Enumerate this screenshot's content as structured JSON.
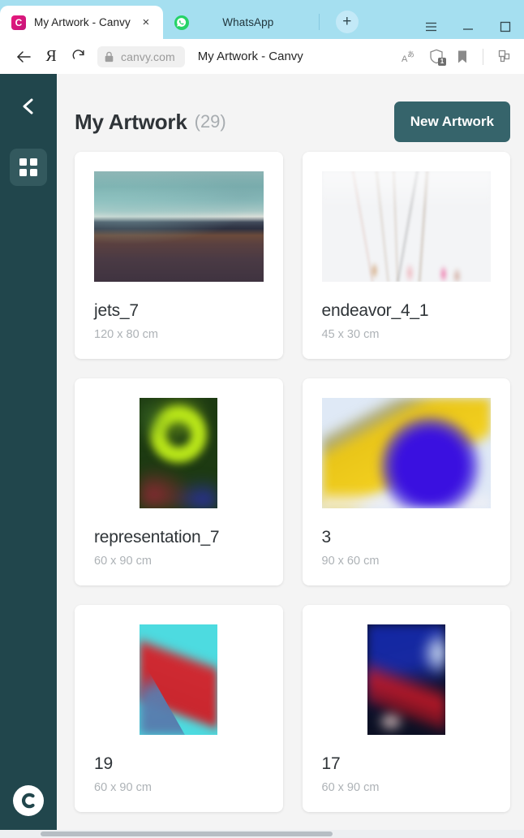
{
  "browser": {
    "tabs": [
      {
        "title": "My Artwork - Canvy",
        "favicon": "canvy-icon",
        "active": true,
        "close_label": "×"
      },
      {
        "title": "WhatsApp",
        "favicon": "whatsapp-icon",
        "active": false
      }
    ],
    "new_tab_label": "+",
    "window_controls": [
      "menu-icon",
      "minimize-icon",
      "maximize-icon"
    ],
    "toolbar": {
      "back_icon": "back-arrow-icon",
      "yandex_label": "Я",
      "reload_icon": "reload-icon",
      "lock_icon": "lock-icon",
      "url": "canvy.com",
      "page_title": "My Artwork - Canvy",
      "right_icons": [
        "translate-icon",
        "shield-icon",
        "bookmark-icon",
        "collections-icon"
      ],
      "shield_badge": "1"
    }
  },
  "sidebar": {
    "back_icon": "chevron-left-icon",
    "grid_icon": "grid-icon",
    "logo_label": "C"
  },
  "header": {
    "title": "My Artwork",
    "count": "(29)",
    "new_artwork_label": "New Artwork"
  },
  "artworks": [
    {
      "name": "jets_7",
      "size": "120 x 80 cm",
      "orientation": "landscape",
      "art_class": "art-jets"
    },
    {
      "name": "endeavor_4_1",
      "size": "45 x 30 cm",
      "orientation": "landscape",
      "art_class": "art-endeavor"
    },
    {
      "name": "representation_7",
      "size": "60 x 90 cm",
      "orientation": "portrait",
      "art_class": "art-rep"
    },
    {
      "name": "3",
      "size": "90 x 60 cm",
      "orientation": "landscape",
      "art_class": "art-three"
    },
    {
      "name": "19",
      "size": "60 x 90 cm",
      "orientation": "portrait",
      "art_class": "art-19"
    },
    {
      "name": "17",
      "size": "60 x 90 cm",
      "orientation": "portrait",
      "art_class": "art-17"
    }
  ],
  "colors": {
    "titlebar": "#a5dff0",
    "sidebar": "#21464c",
    "accent_button": "#36646b",
    "page_bg": "#f4f4f4",
    "favicon_brand": "#e8197d"
  }
}
